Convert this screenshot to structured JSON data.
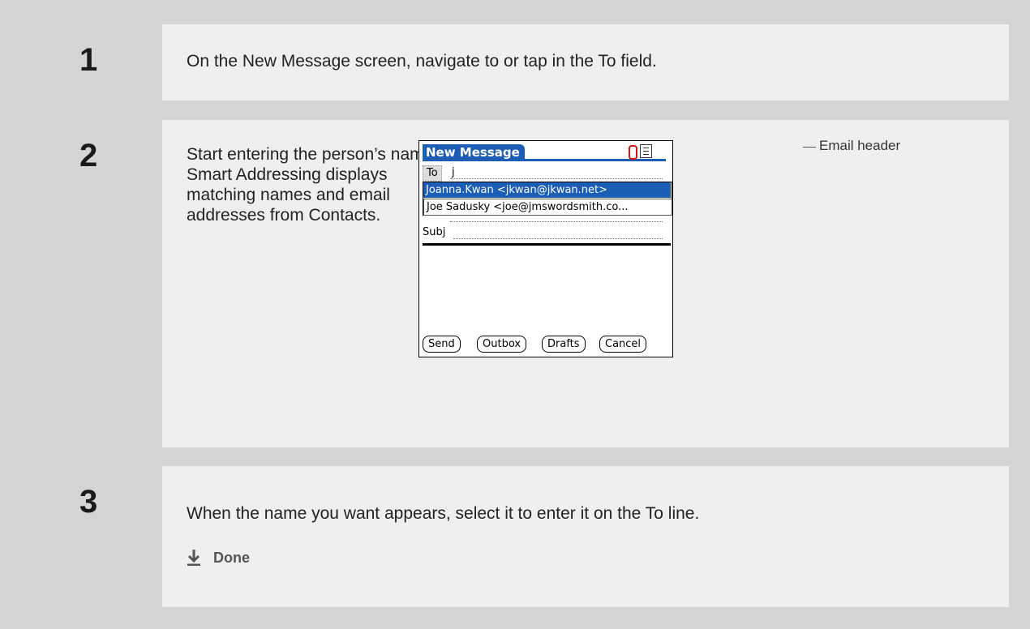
{
  "steps": [
    {
      "number": "1",
      "text": "On the New Message screen, navigate to or tap in the To field."
    },
    {
      "number": "2",
      "text_lines": [
        "Start entering the person’s name.",
        "Smart Addressing displays",
        "matching names and email",
        "addresses from Contacts."
      ]
    },
    {
      "number": "3",
      "text": "When the name you want appears, select it to enter it on the To line.",
      "done_label": "Done"
    }
  ],
  "device": {
    "title": "New Message",
    "to_label": "To",
    "to_value": "j",
    "suggestions": [
      "Joanna.Kwan <jkwan@jkwan.net>",
      "Joe Sadusky <joe@jmswordsmith.co..."
    ],
    "subj_label": "Subj",
    "buttons": [
      "Send",
      "Outbox",
      "Drafts",
      "Cancel"
    ],
    "icons": [
      "attachment-clip-icon",
      "email-header-icon"
    ]
  },
  "callout": "Email header",
  "colors": {
    "accent": "#1c5db5",
    "clip": "#d11111",
    "panel": "#efefef",
    "background": "#d4d4d4"
  }
}
